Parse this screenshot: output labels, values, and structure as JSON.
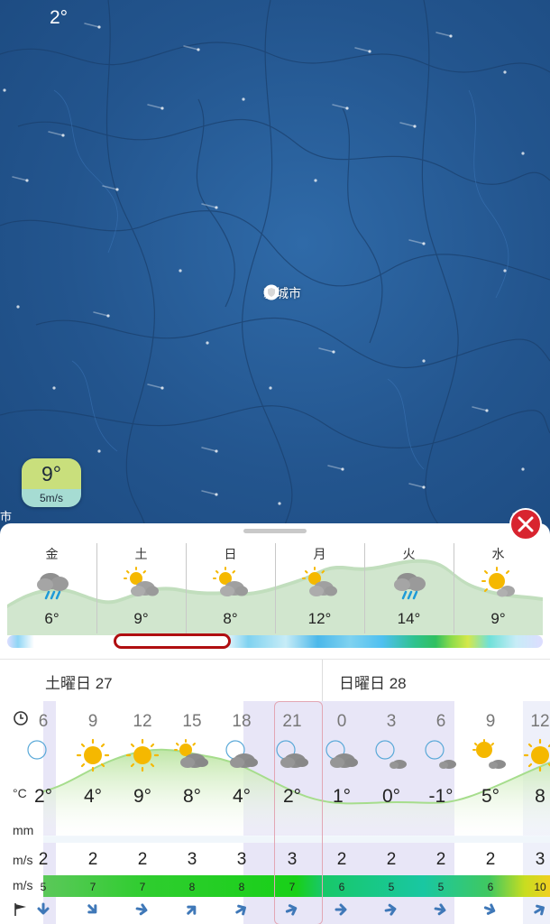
{
  "map": {
    "temp_label": "2°",
    "city_name": "新城市",
    "edge_char": "市",
    "location_badge": {
      "temp": "9°",
      "wind": "5m/s",
      "temp_color": "#c9df7c",
      "wind_color": "#a6dcd3"
    }
  },
  "daily": {
    "days": [
      {
        "name": "金",
        "temp": "6°",
        "icon": "cloud-rain-icon"
      },
      {
        "name": "土",
        "temp": "9°",
        "icon": "sun-cloud-icon"
      },
      {
        "name": "日",
        "temp": "8°",
        "icon": "sun-cloud-icon"
      },
      {
        "name": "月",
        "temp": "12°",
        "icon": "sun-cloud-icon"
      },
      {
        "name": "火",
        "temp": "14°",
        "icon": "cloud-rain-icon"
      },
      {
        "name": "水",
        "temp": "9°",
        "icon": "sun-small-cloud-icon"
      }
    ],
    "close_icon": "close-icon"
  },
  "hourly": {
    "dates": [
      "土曜日 27",
      "日曜日 28"
    ],
    "row_labels": {
      "time_icon": "clock-icon",
      "temp": "°C",
      "precip": "mm",
      "wind": "m/s",
      "gust": "m/s",
      "dir_icon": "wind-direction-icon"
    },
    "hours": [
      {
        "hour": "6",
        "temp": "2°",
        "wind": "2",
        "gust": "5",
        "icon": "moon-icon"
      },
      {
        "hour": "9",
        "temp": "4°",
        "wind": "2",
        "gust": "7",
        "icon": "sun-icon"
      },
      {
        "hour": "12",
        "temp": "9°",
        "wind": "2",
        "gust": "7",
        "icon": "sun-icon"
      },
      {
        "hour": "15",
        "temp": "8°",
        "wind": "3",
        "gust": "8",
        "icon": "sun-cloud-icon"
      },
      {
        "hour": "18",
        "temp": "4°",
        "wind": "3",
        "gust": "8",
        "icon": "moon-cloud-icon"
      },
      {
        "hour": "21",
        "temp": "2°",
        "wind": "3",
        "gust": "7",
        "icon": "moon-cloud-icon"
      },
      {
        "hour": "0",
        "temp": "1°",
        "wind": "2",
        "gust": "6",
        "icon": "moon-cloud-icon"
      },
      {
        "hour": "3",
        "temp": "0°",
        "wind": "2",
        "gust": "5",
        "icon": "moon-small-cloud-icon"
      },
      {
        "hour": "6",
        "temp": "-1°",
        "wind": "2",
        "gust": "5",
        "icon": "moon-small-cloud-icon"
      },
      {
        "hour": "9",
        "temp": "5°",
        "wind": "2",
        "gust": "6",
        "icon": "sun-small-cloud-icon"
      },
      {
        "hour": "12",
        "temp": "8",
        "wind": "3",
        "gust": "10",
        "icon": "sun-icon"
      }
    ]
  }
}
